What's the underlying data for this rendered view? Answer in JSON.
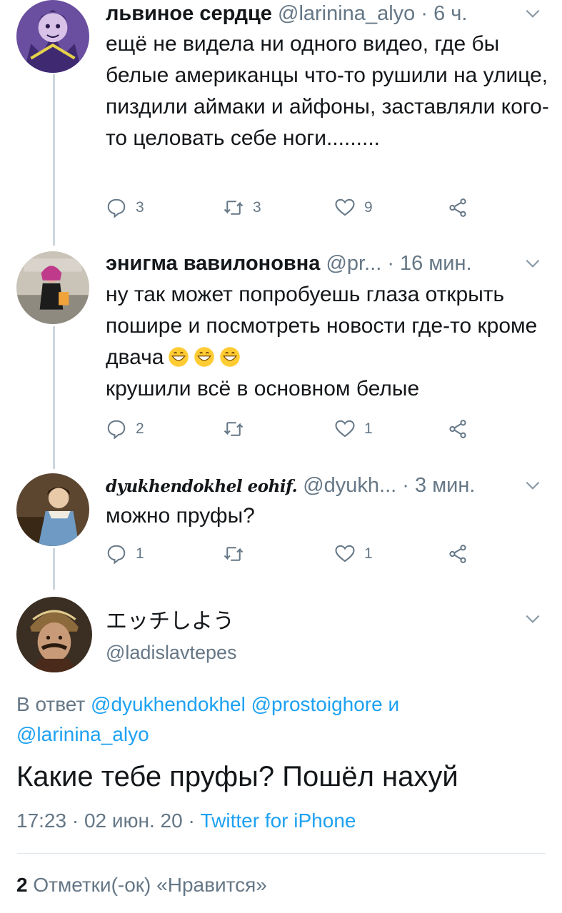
{
  "replies": [
    {
      "name": "львиное сердце",
      "handle": "@larinina_alyo",
      "time": "6 ч.",
      "text": "ещё не видела ни одного видео, где бы белые американцы что-то рушили на улице, пиздили аймаки и айфоны, заставляли кого-то целовать себе ноги.........",
      "reply_count": "3",
      "retweet_count": "3",
      "like_count": "9"
    },
    {
      "name": "энигма вавилоновна",
      "handle": "@pr...",
      "time": "16 мин.",
      "text_line1": "ну так может попробуешь глаза открыть пошире и посмотреть новости где-то кроме двача",
      "text_line2": "крушили всё в основном белые",
      "reply_count": "2",
      "retweet_count": "",
      "like_count": "1"
    },
    {
      "name": "dyukhendokhel eohif.",
      "handle": "@dyukh...",
      "time": "3 мин.",
      "text": "можно пруфы?",
      "reply_count": "1",
      "retweet_count": "",
      "like_count": "1"
    }
  ],
  "main_tweet": {
    "name": "エッチしよう",
    "handle": "@ladislavtepes",
    "reply_prefix": "В ответ",
    "mention1": "@dyukhendokhel",
    "mention2": "@prostoighore",
    "reply_and": "и",
    "mention3": "@larinina_alyo",
    "text": "Какие тебе пруфы? Пошёл нахуй",
    "time": "17:23",
    "date": "02 июн. 20",
    "source": "Twitter for iPhone",
    "separator": "·",
    "likes_count": "2",
    "likes_label": "Отметки(-ок) «Нравится»"
  },
  "colors": {
    "accent": "#1da1f2",
    "secondary_text": "#657786",
    "thread_line": "#ccd6dd"
  },
  "icons": [
    "reply-icon",
    "retweet-icon",
    "like-icon",
    "share-icon",
    "chevron-down-icon",
    "grinning-emoji-icon"
  ]
}
